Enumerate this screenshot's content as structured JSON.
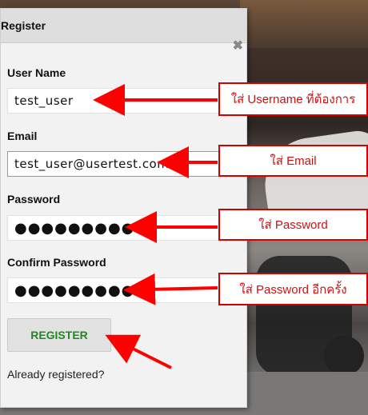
{
  "modal": {
    "title": "Register",
    "close_icon": "close-icon"
  },
  "form": {
    "username_label": "User Name",
    "username_value": "test_user",
    "email_label": "Email",
    "email_value": "test_user@usertest.com",
    "password_label": "Password",
    "password_value": "●●●●●●●●●",
    "confirm_label": "Confirm Password",
    "confirm_value": "●●●●●●●●●",
    "register_label": "REGISTER",
    "already_label": "Already registered?"
  },
  "annotations": {
    "username_note": "ใส่ Username  ที่ต้องการ",
    "email_note": "ใส่ Email",
    "password_note": "ใส่ Password",
    "confirm_note": "ใส่ Password  อีกครั้ง"
  },
  "colors": {
    "accent_red": "#ff0000",
    "register_text": "#1e8a1e"
  }
}
